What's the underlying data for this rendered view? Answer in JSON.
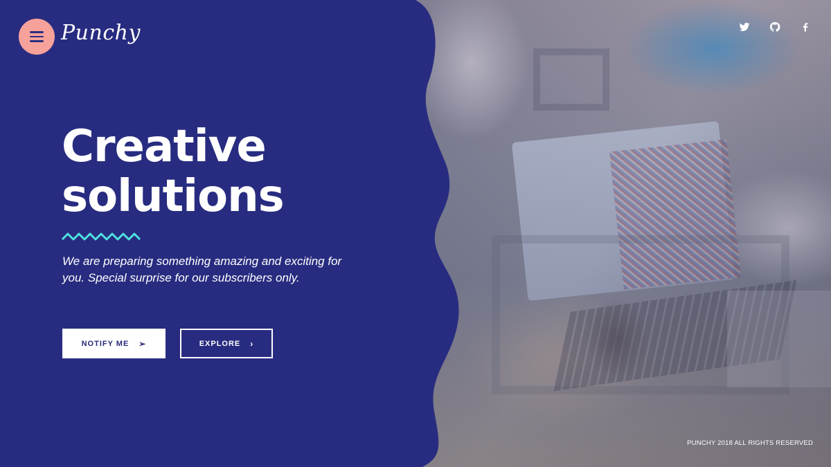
{
  "brand": {
    "logo_text": "Punchy",
    "panel_color": "#282c80",
    "accent_color": "#f6a29a",
    "zigzag_color": "#4ee2e0"
  },
  "header": {
    "menu_icon": "hamburger-icon",
    "social": [
      {
        "name": "twitter-icon"
      },
      {
        "name": "github-icon"
      },
      {
        "name": "facebook-icon"
      }
    ]
  },
  "hero": {
    "title_line1": "Creative",
    "title_line2": "solutions",
    "description": "We are preparing something amazing and exciting for you. Special surprise for our subscribers only.",
    "notify_label": "NOTIFY ME",
    "notify_icon": "send-arrow-icon",
    "explore_label": "EXPLORE",
    "explore_icon": "chevron-right-icon"
  },
  "footer": {
    "copyright": "PUNCHY 2018 ALL RIGHTS RESERVED"
  }
}
